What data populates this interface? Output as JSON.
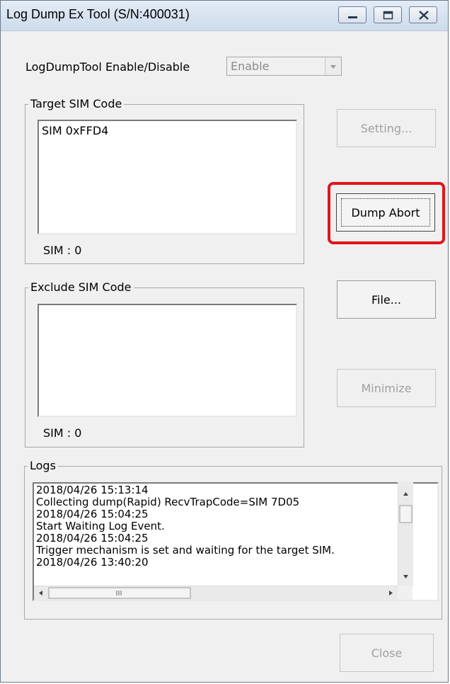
{
  "window": {
    "title": "Log Dump Ex Tool (S/N:400031)"
  },
  "enable_row": {
    "label": "LogDumpTool Enable/Disable",
    "combo_value": "Enable"
  },
  "target_group": {
    "label": "Target SIM Code",
    "items": [
      "SIM 0xFFD4"
    ],
    "count_label": "SIM : 0"
  },
  "exclude_group": {
    "label": "Exclude SIM Code",
    "items": [],
    "count_label": "SIM : 0"
  },
  "buttons": {
    "setting": "Setting...",
    "dump_abort": "Dump Abort",
    "file": "File...",
    "minimize": "Minimize",
    "close": "Close"
  },
  "logs": {
    "label": "Logs",
    "lines": [
      "2018/04/26 15:13:14",
      "Collecting dump(Rapid) RecvTrapCode=SIM 7D05",
      "2018/04/26 15:04:25",
      "Start Waiting Log Event.",
      "2018/04/26 15:04:25",
      "Trigger mechanism is set and waiting for the target SIM.",
      "2018/04/26 13:40:20"
    ]
  },
  "colors": {
    "highlight": "#e0161b",
    "disabled_text": "#a0a0a0"
  },
  "icons": [
    "minimize-icon",
    "maximize-icon",
    "close-icon",
    "dropdown-arrow-icon",
    "scroll-up-icon",
    "scroll-down-icon",
    "scroll-left-icon",
    "scroll-right-icon"
  ]
}
